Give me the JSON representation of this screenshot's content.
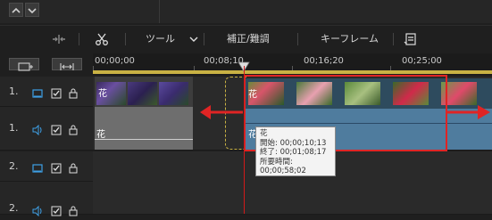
{
  "toolbar": {
    "tools_label": "ツール",
    "correction_label": "補正/難調",
    "keyframe_label": "キーフレーム"
  },
  "ruler": {
    "ticks": [
      "00;00;00",
      "00;08;10",
      "00;16;20",
      "00;25;00"
    ]
  },
  "tracks": [
    {
      "number": "1.",
      "type": "video"
    },
    {
      "number": "1.",
      "type": "audio"
    },
    {
      "number": "2.",
      "type": "video"
    },
    {
      "number": "2.",
      "type": "audio"
    }
  ],
  "clips": {
    "left_clip_label": "花",
    "left_audio_label": "花",
    "right_clip_label": "花",
    "right_audio_label": "花"
  },
  "tooltip": {
    "title": "花",
    "start": "開始: 00;00;10;13",
    "end": "終了: 00;01;08;17",
    "duration": "所要時間: 00;00;58;02"
  },
  "colors": {
    "accent_red": "#e02424",
    "timeline_range": "#c9b244",
    "clip_blue": "#4f7c9e"
  }
}
